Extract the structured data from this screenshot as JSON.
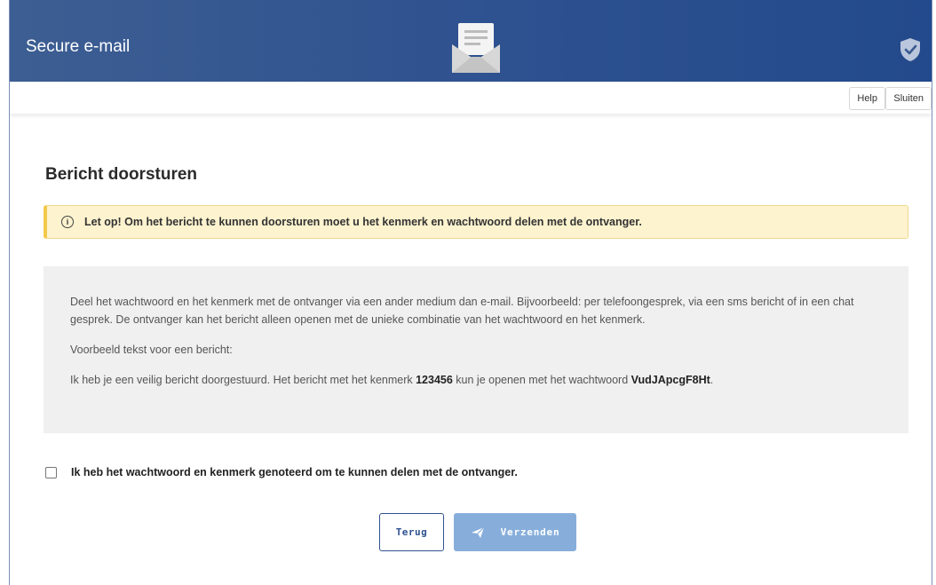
{
  "header": {
    "title": "Secure e-mail",
    "icons": [
      "envelope-icon",
      "shield-check-icon"
    ],
    "background_color": "#2f5290"
  },
  "toolbar": {
    "help_label": "Help",
    "close_label": "Sluiten"
  },
  "page": {
    "title": "Bericht doorsturen"
  },
  "alert": {
    "icon": "info-icon",
    "icon_glyph": "i",
    "text": "Let op! Om het bericht te kunnen doorsturen moet u het kenmerk en wachtwoord delen met de ontvanger.",
    "color": "#fdf3cf"
  },
  "info": {
    "paragraph1": "Deel het wachtwoord en het kenmerk met de ontvanger via een ander medium dan e-mail. Bijvoorbeeld: per telefoongesprek, via een sms bericht of in een chat gesprek. De ontvanger kan het bericht alleen openen met de unieke combinatie van het wachtwoord en het kenmerk.",
    "example_label": "Voorbeeld tekst voor een bericht:",
    "example_part1": "Ik heb je een veilig bericht doorgestuurd. Het bericht met het kenmerk ",
    "reference": "123456",
    "example_part2": " kun je openen met het wachtwoord ",
    "password": "VudJApcgF8Ht",
    "example_end": "."
  },
  "confirm": {
    "label": "Ik heb het wachtwoord en kenmerk genoteerd om te kunnen delen met de ontvanger.",
    "checked": false
  },
  "actions": {
    "back_label": "Terug",
    "send_label": "Verzenden",
    "send_icon": "paper-plane-icon",
    "primary_color": "#87aedb"
  }
}
